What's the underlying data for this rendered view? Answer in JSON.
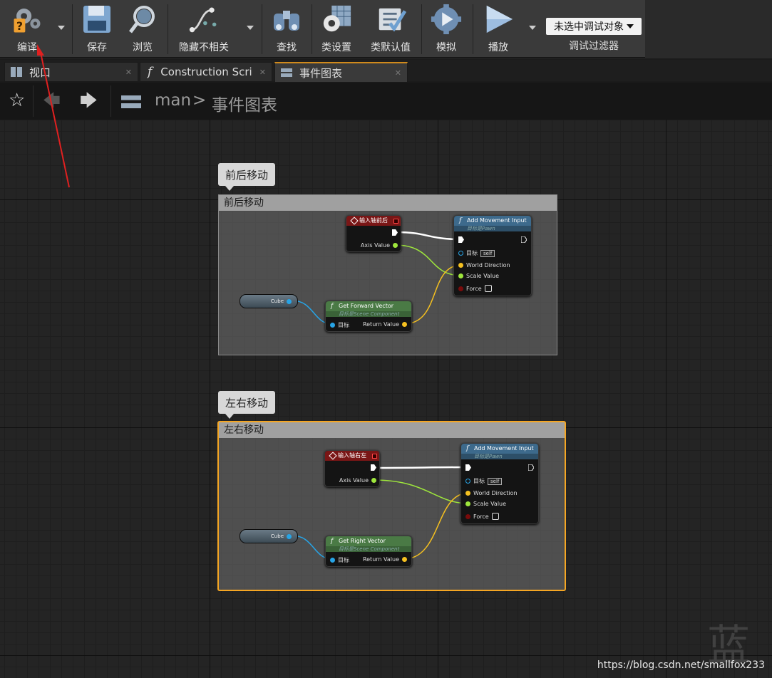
{
  "toolbar": {
    "compile": "编译",
    "save": "保存",
    "browse": "浏览",
    "hide_unrelated": "隐藏不相关",
    "find": "查找",
    "class_settings": "类设置",
    "class_defaults": "类默认值",
    "simulate": "模拟",
    "play": "播放",
    "debug_select": "未选中调试对象",
    "debug_filter": "调试过滤器"
  },
  "tabs": [
    {
      "label": "视口"
    },
    {
      "label": "Construction Scrip"
    },
    {
      "label": "事件图表"
    }
  ],
  "breadcrumb": {
    "root": "man",
    "separator": ">",
    "current": "事件图表"
  },
  "comments": [
    {
      "bubble": "前后移动",
      "header": "前后移动",
      "axis_node": {
        "title": "输入轴前后",
        "pin": "Axis Value"
      },
      "move_node": {
        "title": "Add Movement Input",
        "subtitle": "目标是Pawn",
        "target": "目标",
        "self": "self",
        "dir": "World Direction",
        "scale": "Scale Value",
        "force": "Force"
      },
      "vector_node": {
        "title": "Get Forward Vector",
        "subtitle": "目标是Scene Component",
        "target": "目标",
        "ret": "Return Value"
      },
      "var": "Cube"
    },
    {
      "bubble": "左右移动",
      "header": "左右移动",
      "axis_node": {
        "title": "输入轴右左",
        "pin": "Axis Value"
      },
      "move_node": {
        "title": "Add Movement Input",
        "subtitle": "目标是Pawn",
        "target": "目标",
        "self": "self",
        "dir": "World Direction",
        "scale": "Scale Value",
        "force": "Force"
      },
      "vector_node": {
        "title": "Get Right Vector",
        "subtitle": "目标是Scene Component",
        "target": "目标",
        "ret": "Return Value"
      },
      "var": "Cube"
    }
  ],
  "watermark": "蓝",
  "credit": "https://blog.csdn.net/smallfox233",
  "colors": {
    "exec": "#ffffff",
    "float": "#9ee63c",
    "vector": "#f5c020",
    "object": "#27a4e6",
    "event_header": "#8b1a1a",
    "func_header": "#3d6a8c",
    "pure_header": "#4a7a45",
    "selected": "#f5a623"
  }
}
